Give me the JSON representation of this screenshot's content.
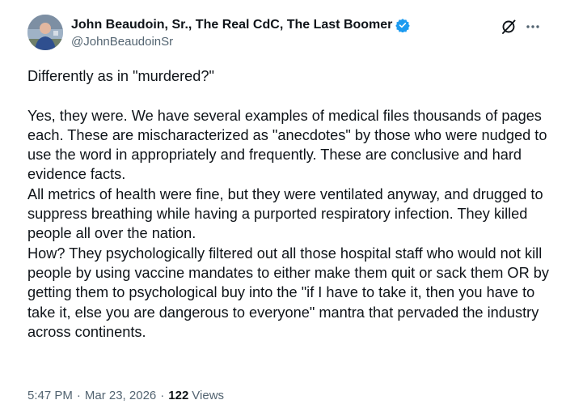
{
  "author": {
    "display_name": "John Beaudoin, Sr., The Real CdC, The Last Boomer",
    "handle": "@JohnBeaudoinSr",
    "verified": true,
    "verified_color": "#1d9bf0"
  },
  "actions": {
    "grok_icon": "grok-slash-circle-icon",
    "more_icon": "more-dots-icon"
  },
  "tweet": {
    "line1": "Differently as in \"murdered?\"",
    "para2": "Yes, they were. We have several examples of medical files thousands of pages each. These are mischaracterized as \"anecdotes\" by those who were nudged to use the word in appropriately and frequently. These are conclusive and hard evidence facts.",
    "para3": "All metrics of health were fine, but they were ventilated anyway, and drugged to suppress breathing while having a purported respiratory infection. They killed people all over the nation.",
    "para4": "How? They psychologically filtered out all those hospital staff who would not kill people by using vaccine mandates to either make them quit or sack them OR by getting them to psychological buy into the \"if I have to take it, then you have to take it, else you are dangerous to everyone\" mantra that pervaded the industry across continents."
  },
  "meta": {
    "time": "5:47 PM",
    "separator1": "·",
    "date": "Mar 23, 2026",
    "separator2": "·",
    "views_count": "122",
    "views_label": "Views"
  },
  "colors": {
    "text": "#0f1419",
    "secondary": "#536471",
    "accent": "#1d9bf0"
  }
}
